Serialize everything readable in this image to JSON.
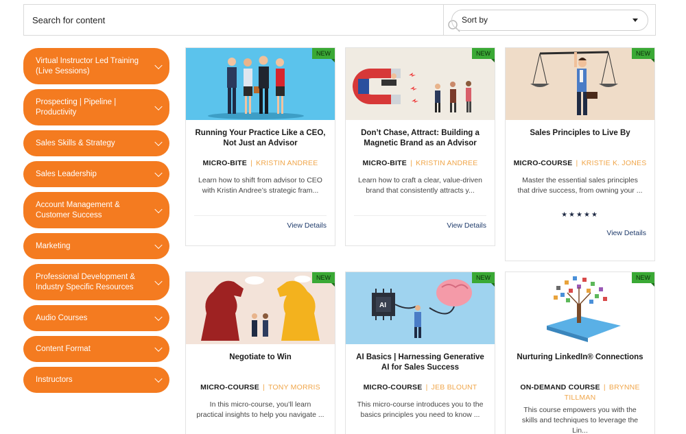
{
  "search": {
    "placeholder": "Search for content"
  },
  "sort": {
    "label": "Sort by"
  },
  "categories": [
    {
      "label": "Virtual Instructor Led Training (Live Sessions)"
    },
    {
      "label": "Prospecting | Pipeline | Productivity"
    },
    {
      "label": "Sales Skills & Strategy"
    },
    {
      "label": "Sales Leadership"
    },
    {
      "label": "Account Management & Customer Success"
    },
    {
      "label": "Marketing"
    },
    {
      "label": "Professional Development & Industry Specific Resources"
    },
    {
      "label": "Audio Courses"
    },
    {
      "label": "Content Format"
    },
    {
      "label": "Instructors"
    }
  ],
  "colors": {
    "accent": "#f47b20",
    "badge": "#3aa935",
    "link": "#1f3b6b",
    "author": "#f0a64a"
  },
  "cards": [
    {
      "badge": "NEW",
      "title": "Running Your Practice Like a CEO, Not Just an Advisor",
      "type": "MICRO-BITE",
      "sep": "|",
      "author": "KRISTIN ANDREE",
      "desc": "Learn how to shift from advisor to CEO with Kristin Andree’s strategic fram...",
      "cta": "View Details"
    },
    {
      "badge": "NEW",
      "title": "Don’t Chase, Attract: Building a Magnetic Brand as an Advisor",
      "type": "MICRO-BITE",
      "sep": "|",
      "author": "KRISTIN ANDREE",
      "desc": "Learn how to craft a clear, value-driven brand that consistently attracts y...",
      "cta": "View Details"
    },
    {
      "badge": "NEW",
      "title": "Sales Principles to Live By",
      "type": "MICRO-COURSE",
      "sep": "|",
      "author": "KRISTIE K. JONES",
      "desc": "Master the essential sales principles that drive success, from owning your ...",
      "rating": "★★★★★",
      "cta": "View Details"
    },
    {
      "badge": "NEW",
      "title": "Negotiate to Win",
      "type": "MICRO-COURSE",
      "sep": "|",
      "author": "TONY MORRIS",
      "desc": "In this micro-course, you’ll learn practical insights to help you navigate ..."
    },
    {
      "badge": "NEW",
      "title": "AI Basics | Harnessing Generative AI for Sales Success",
      "type": "MICRO-COURSE",
      "sep": "|",
      "author": "JEB BLOUNT",
      "desc": "This micro-course introduces you to the basics principles you need to know ..."
    },
    {
      "badge": "NEW",
      "title": "Nurturing LinkedIn® Connections",
      "type": "ON-DEMAND COURSE",
      "sep": "|",
      "author": "BRYNNE TILLMAN",
      "desc": "This course empowers you with the skills and techniques to leverage the Lin..."
    }
  ]
}
